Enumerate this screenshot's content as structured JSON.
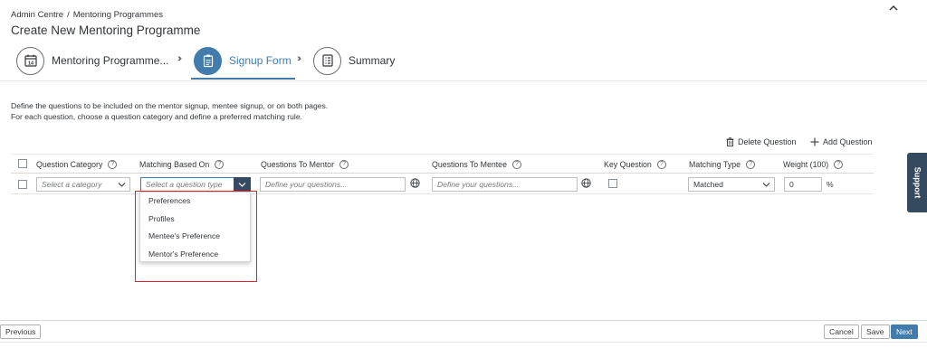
{
  "breadcrumb": {
    "items": [
      "Admin Centre",
      "Mentoring Programmes"
    ],
    "separator": "/"
  },
  "page_title": "Create New Mentoring Programme",
  "steps": [
    {
      "label": "Mentoring Programme...",
      "icon": "calendar-14-icon",
      "calendar_number": "14"
    },
    {
      "label": "Signup Form",
      "icon": "clipboard-icon",
      "active": true
    },
    {
      "label": "Summary",
      "icon": "list-icon"
    }
  ],
  "description": {
    "line1": "Define the questions to be included on the mentor signup, mentee signup, or on both pages.",
    "line2": "For each question, choose a question category and define a preferred matching rule."
  },
  "toolbar": {
    "delete_label": "Delete Question",
    "add_label": "Add Question"
  },
  "table": {
    "columns": [
      "Question Category",
      "Matching Based On",
      "Questions To Mentor",
      "Questions To Mentee",
      "Key Question",
      "Matching Type",
      "Weight (100)"
    ],
    "row": {
      "category_placeholder": "Select a category",
      "matching_placeholder": "Select a question type",
      "mentor_placeholder": "Define your questions...",
      "mentee_placeholder": "Define your questions...",
      "matching_type": "Matched",
      "weight": "0",
      "weight_unit": "%"
    }
  },
  "dropdown": {
    "options": [
      "Preferences",
      "Profiles",
      "Mentee's Preference",
      "Mentor's Preference"
    ]
  },
  "support_label": "Support",
  "footer": {
    "previous": "Previous",
    "cancel": "Cancel",
    "save": "Save",
    "next": "Next"
  },
  "colors": {
    "accent": "#427cac",
    "shell_dark": "#354a5f",
    "highlight_red": "#e0262b"
  }
}
